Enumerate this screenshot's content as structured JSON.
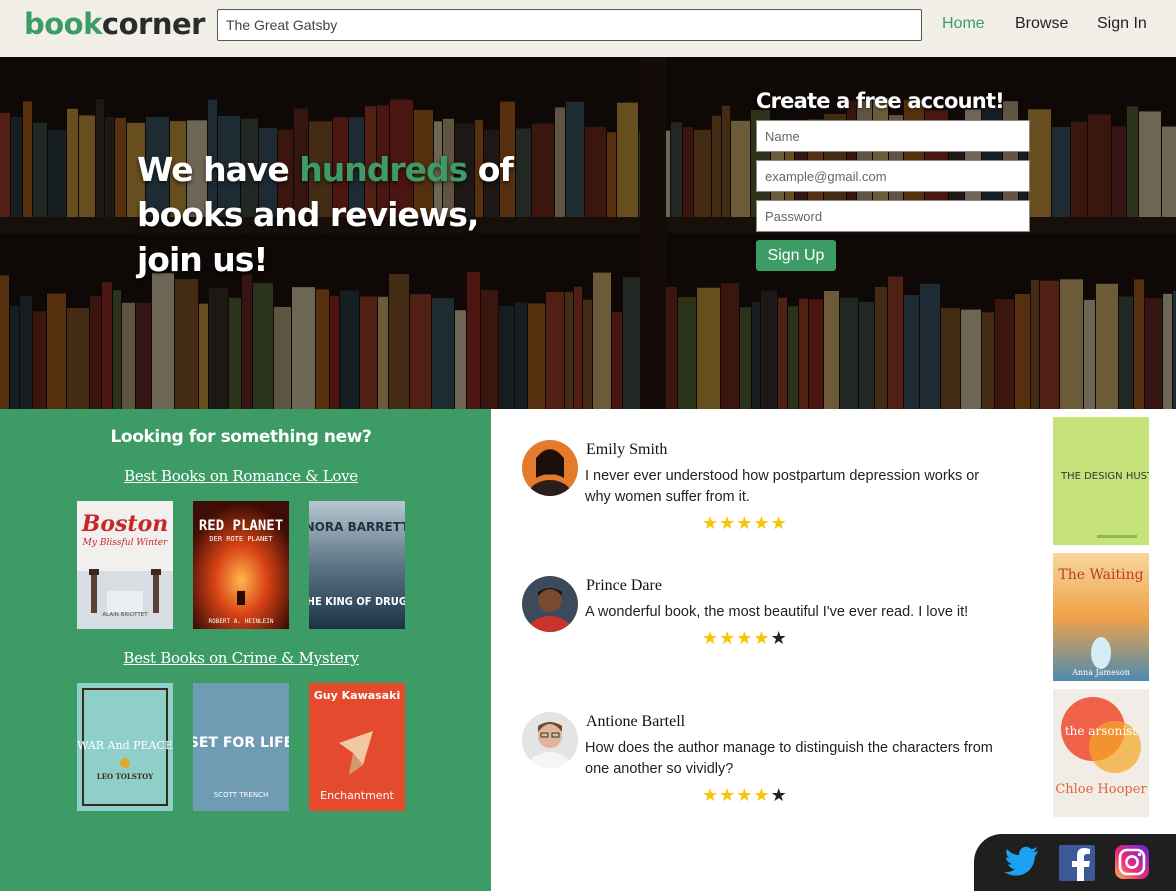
{
  "header": {
    "logo_part1": "book",
    "logo_part2": "corner",
    "search_value": "The Great Gatsby",
    "nav": {
      "home": "Home",
      "browse": "Browse",
      "signin": "Sign In"
    }
  },
  "hero": {
    "line1_pre": "We have ",
    "line1_highlight": "hundreds",
    "line1_post": " of",
    "line2": "books and reviews,",
    "line3": "join us!"
  },
  "signup": {
    "title": "Create a free account!",
    "name_placeholder": "Name",
    "email_placeholder": "example@gmail.com",
    "password_placeholder": "Password",
    "button": "Sign Up"
  },
  "discover": {
    "heading": "Looking for something new?",
    "categories": [
      {
        "label": "Best Books on Romance & Love",
        "books": [
          {
            "title": "Boston",
            "subtitle": "My Blissful Winter",
            "author": "ALAIN BRIOTTET"
          },
          {
            "title": "RED PLANET",
            "subtitle": "DER ROTE PLANET",
            "author": "ROBERT A. HEINLEIN"
          },
          {
            "title": "THE KING OF DRUGS",
            "author": "NORA BARRETT"
          }
        ]
      },
      {
        "label": "Best Books on Crime & Mystery",
        "books": [
          {
            "title": "WAR And PEACE",
            "author": "LEO TOLSTOY"
          },
          {
            "title": "SET FOR LIFE",
            "author": "SCOTT TRENCH"
          },
          {
            "title": "Enchantment",
            "author": "Guy Kawasaki"
          }
        ]
      }
    ]
  },
  "reviews": [
    {
      "name": "Emily Smith",
      "text": "I never ever understood how postpartum depression works or why women suffer from it.",
      "rating": 5
    },
    {
      "name": "Prince Dare",
      "text": "A wonderful book, the most beautiful I've ever read. I love it!",
      "rating": 4
    },
    {
      "name": "Antione Bartell",
      "text": "How does the author manage to distinguish the characters from one another so vividly?",
      "rating": 4
    }
  ],
  "side_books": [
    {
      "title": "THE DESIGN HUSTLE"
    },
    {
      "title": "The Waiting",
      "author": "Anna Jameson"
    },
    {
      "title": "the arsonist",
      "author": "Chloe Hooper"
    }
  ],
  "social": [
    "twitter-icon",
    "facebook-icon",
    "instagram-icon"
  ],
  "colors": {
    "accent": "#3d9b66",
    "header_bg": "#f2efe8",
    "star": "#f7c600"
  }
}
